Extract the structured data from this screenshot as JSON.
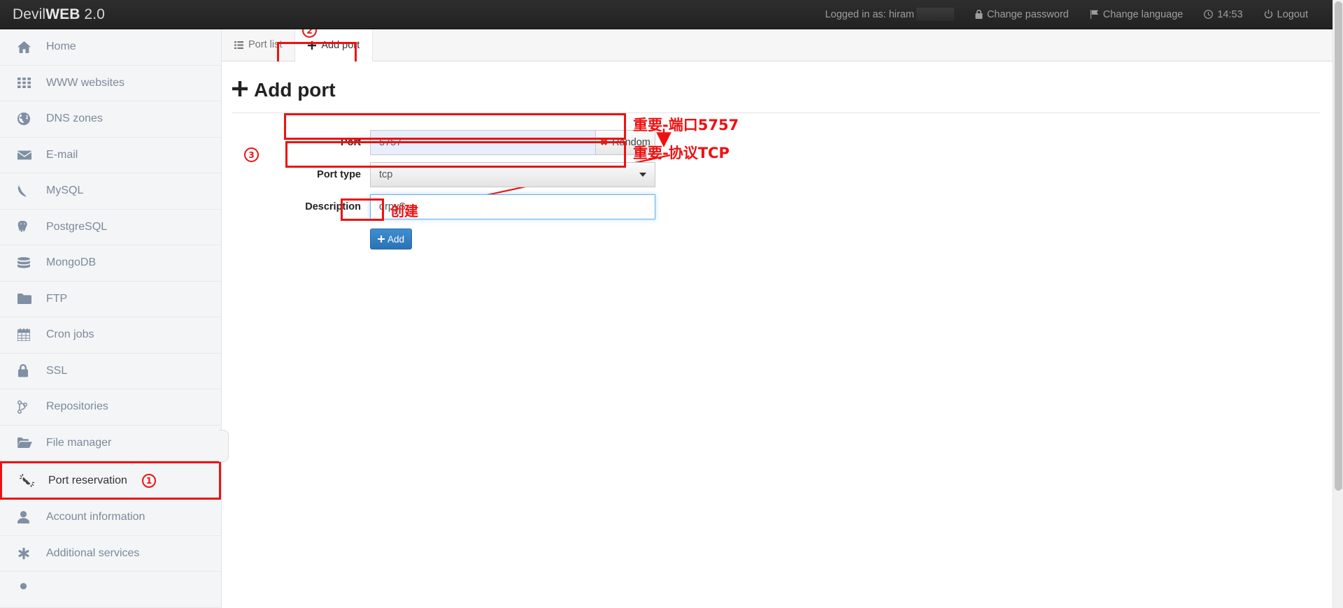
{
  "header": {
    "brand_prefix": "Devil",
    "brand_bold": "WEB",
    "brand_version": " 2.0",
    "logged_in_label": "Logged in as: hiram",
    "change_password": "Change password",
    "change_language": "Change language",
    "time": "14:53",
    "logout": "Logout"
  },
  "sidebar": {
    "items": [
      {
        "label": "Home",
        "icon": "home-icon",
        "badge": ""
      },
      {
        "label": "WWW websites",
        "icon": "grid-icon",
        "badge": ""
      },
      {
        "label": "DNS zones",
        "icon": "globe-icon",
        "badge": ""
      },
      {
        "label": "E-mail",
        "icon": "envelope-icon",
        "badge": ""
      },
      {
        "label": "MySQL",
        "icon": "dolphin-icon",
        "badge": ""
      },
      {
        "label": "PostgreSQL",
        "icon": "elephant-icon",
        "badge": ""
      },
      {
        "label": "MongoDB",
        "icon": "database-icon",
        "badge": ""
      },
      {
        "label": "FTP",
        "icon": "folder-icon",
        "badge": ""
      },
      {
        "label": "Cron jobs",
        "icon": "calendar-icon",
        "badge": ""
      },
      {
        "label": "SSL",
        "icon": "lock-icon",
        "badge": ""
      },
      {
        "label": "Repositories",
        "icon": "code-branch-icon",
        "badge": ""
      },
      {
        "label": "File manager",
        "icon": "folder-open-icon",
        "badge": ""
      },
      {
        "label": "Port reservation",
        "icon": "plug-icon",
        "badge": "1"
      },
      {
        "label": "Account information",
        "icon": "user-icon",
        "badge": ""
      },
      {
        "label": "Additional services",
        "icon": "asterisk-icon",
        "badge": ""
      }
    ]
  },
  "tabs": {
    "port_list": "Port list",
    "add_port": "Add port",
    "active_badge": "2"
  },
  "page": {
    "title": "Add port"
  },
  "form": {
    "port_label": "Port",
    "port_value": "5757",
    "random_label": "Random",
    "port_type_label": "Port type",
    "port_type_value": "tcp",
    "description_label": "Description",
    "description_value": "drpyS",
    "add_label": "Add",
    "step_badge": "3"
  },
  "annotations": {
    "port_note": "重要-端口5757",
    "tcp_note": "重要-协议TCP",
    "create_note": "创建"
  },
  "colors": {
    "annotation_red": "#ee1111",
    "primary_blue": "#2a72b5",
    "sidebar_text": "#7b8a9c",
    "topbar_bg": "#2e2e2e"
  }
}
